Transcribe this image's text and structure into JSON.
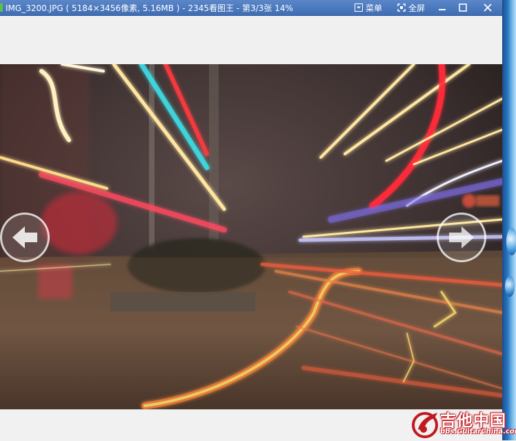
{
  "window": {
    "title": "IMG_3200.JPG ( 5184×3456像素, 5.16MB ) - 2345看图王 - 第3/3张 14%",
    "menu_label": "菜单",
    "fullscreen_label": "全屏"
  },
  "watermark": {
    "brand": "吉他中国",
    "url": "bbs.GuitarChina.com"
  },
  "colors": {
    "titlebar": "#3f6db4",
    "light_trail_red": "#ff2a3a",
    "light_trail_yellow": "#ffe08a",
    "light_trail_cyan": "#3fe0e8"
  },
  "icons": {
    "menu": "dropdown-box-icon",
    "fullscreen": "fullscreen-icon",
    "minimize": "minimize-icon",
    "maximize": "maximize-icon",
    "close": "close-icon",
    "prev": "arrow-left-icon",
    "next": "arrow-right-icon"
  }
}
